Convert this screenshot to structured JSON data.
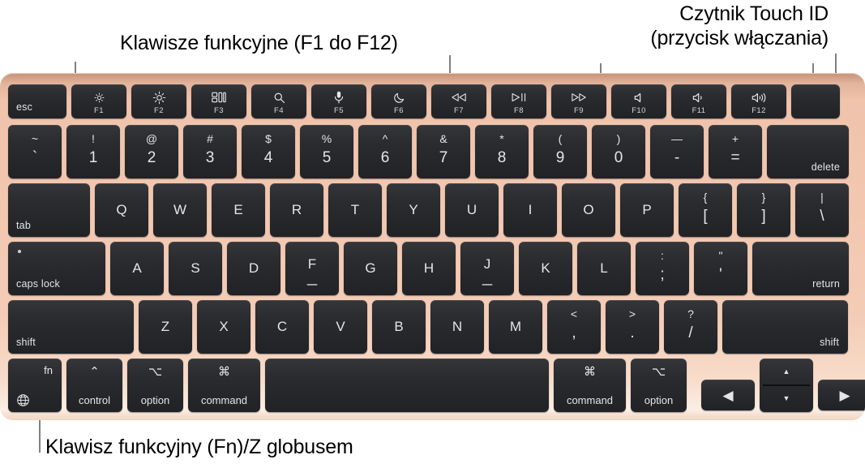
{
  "callouts": {
    "function_keys": "Klawisze funkcyjne (F1 do F12)",
    "touch_id_line1": "Czytnik Touch ID",
    "touch_id_line2": "(przycisk włączania)",
    "fn_key": "Klawisz funkcyjny (Fn)/Z globusem"
  },
  "colors": {
    "keyboard_body": "#f2c7b0",
    "key": "#2a2c30",
    "key_text": "#e3e5e8",
    "leader_line": "#808080",
    "caption_text": "#000000"
  },
  "keyboard": {
    "function_row": [
      {
        "label": "esc",
        "kind": "word-left",
        "icon": ""
      },
      {
        "label": "F1",
        "kind": "fn",
        "icon": "brightness-low-icon"
      },
      {
        "label": "F2",
        "kind": "fn",
        "icon": "brightness-high-icon"
      },
      {
        "label": "F3",
        "kind": "fn",
        "icon": "mission-control-icon"
      },
      {
        "label": "F4",
        "kind": "fn",
        "icon": "spotlight-search-icon"
      },
      {
        "label": "F5",
        "kind": "fn",
        "icon": "microphone-dictation-icon"
      },
      {
        "label": "F6",
        "kind": "fn",
        "icon": "do-not-disturb-moon-icon"
      },
      {
        "label": "F7",
        "kind": "fn",
        "icon": "rewind-previous-icon"
      },
      {
        "label": "F8",
        "kind": "fn",
        "icon": "play-pause-icon"
      },
      {
        "label": "F9",
        "kind": "fn",
        "icon": "fast-forward-next-icon"
      },
      {
        "label": "F10",
        "kind": "fn",
        "icon": "volume-mute-icon"
      },
      {
        "label": "F11",
        "kind": "fn",
        "icon": "volume-down-icon"
      },
      {
        "label": "F12",
        "kind": "fn",
        "icon": "volume-up-icon"
      },
      {
        "label": "",
        "kind": "touchid",
        "icon": "touch-id-power-button-icon"
      }
    ],
    "number_row": [
      {
        "top": "~",
        "bottom": "`"
      },
      {
        "top": "!",
        "bottom": "1"
      },
      {
        "top": "@",
        "bottom": "2"
      },
      {
        "top": "#",
        "bottom": "3"
      },
      {
        "top": "$",
        "bottom": "4"
      },
      {
        "top": "%",
        "bottom": "5"
      },
      {
        "top": "^",
        "bottom": "6"
      },
      {
        "top": "&",
        "bottom": "7"
      },
      {
        "top": "*",
        "bottom": "8"
      },
      {
        "top": "(",
        "bottom": "9"
      },
      {
        "top": ")",
        "bottom": "0"
      },
      {
        "top": "—",
        "bottom": "-"
      },
      {
        "top": "+",
        "bottom": "="
      },
      {
        "label": "delete"
      }
    ],
    "top_letter_row": {
      "tab": "tab",
      "letters": [
        "Q",
        "W",
        "E",
        "R",
        "T",
        "Y",
        "U",
        "I",
        "O",
        "P"
      ],
      "brackets": [
        {
          "top": "{",
          "bottom": "["
        },
        {
          "top": "}",
          "bottom": "]"
        },
        {
          "top": "|",
          "bottom": "\\"
        }
      ]
    },
    "home_row": {
      "caps_lock": "caps lock",
      "letters": [
        "A",
        "S",
        "D",
        "F",
        "G",
        "H",
        "J",
        "K",
        "L"
      ],
      "bump_keys": [
        "F",
        "J"
      ],
      "punct": [
        {
          "top": ":",
          "bottom": ";"
        },
        {
          "top": "\"",
          "bottom": "'"
        }
      ],
      "return": "return"
    },
    "bottom_letter_row": {
      "shift_left": "shift",
      "letters": [
        "Z",
        "X",
        "C",
        "V",
        "B",
        "N",
        "M"
      ],
      "punct": [
        {
          "top": "<",
          "bottom": ","
        },
        {
          "top": ">",
          "bottom": "."
        },
        {
          "top": "?",
          "bottom": "/"
        }
      ],
      "shift_right": "shift"
    },
    "modifier_row": {
      "fn": {
        "word": "fn",
        "icon": "globe-icon"
      },
      "control": {
        "symbol": "⌃",
        "word": "control"
      },
      "option_left": {
        "symbol": "⌥",
        "word": "option"
      },
      "command_left": {
        "symbol": "⌘",
        "word": "command"
      },
      "space": "",
      "command_right": {
        "symbol": "⌘",
        "word": "command"
      },
      "option_right": {
        "symbol": "⌥",
        "word": "option"
      },
      "arrow_left": "◀",
      "arrow_up": "▲",
      "arrow_down": "▼",
      "arrow_right": "▶"
    }
  }
}
